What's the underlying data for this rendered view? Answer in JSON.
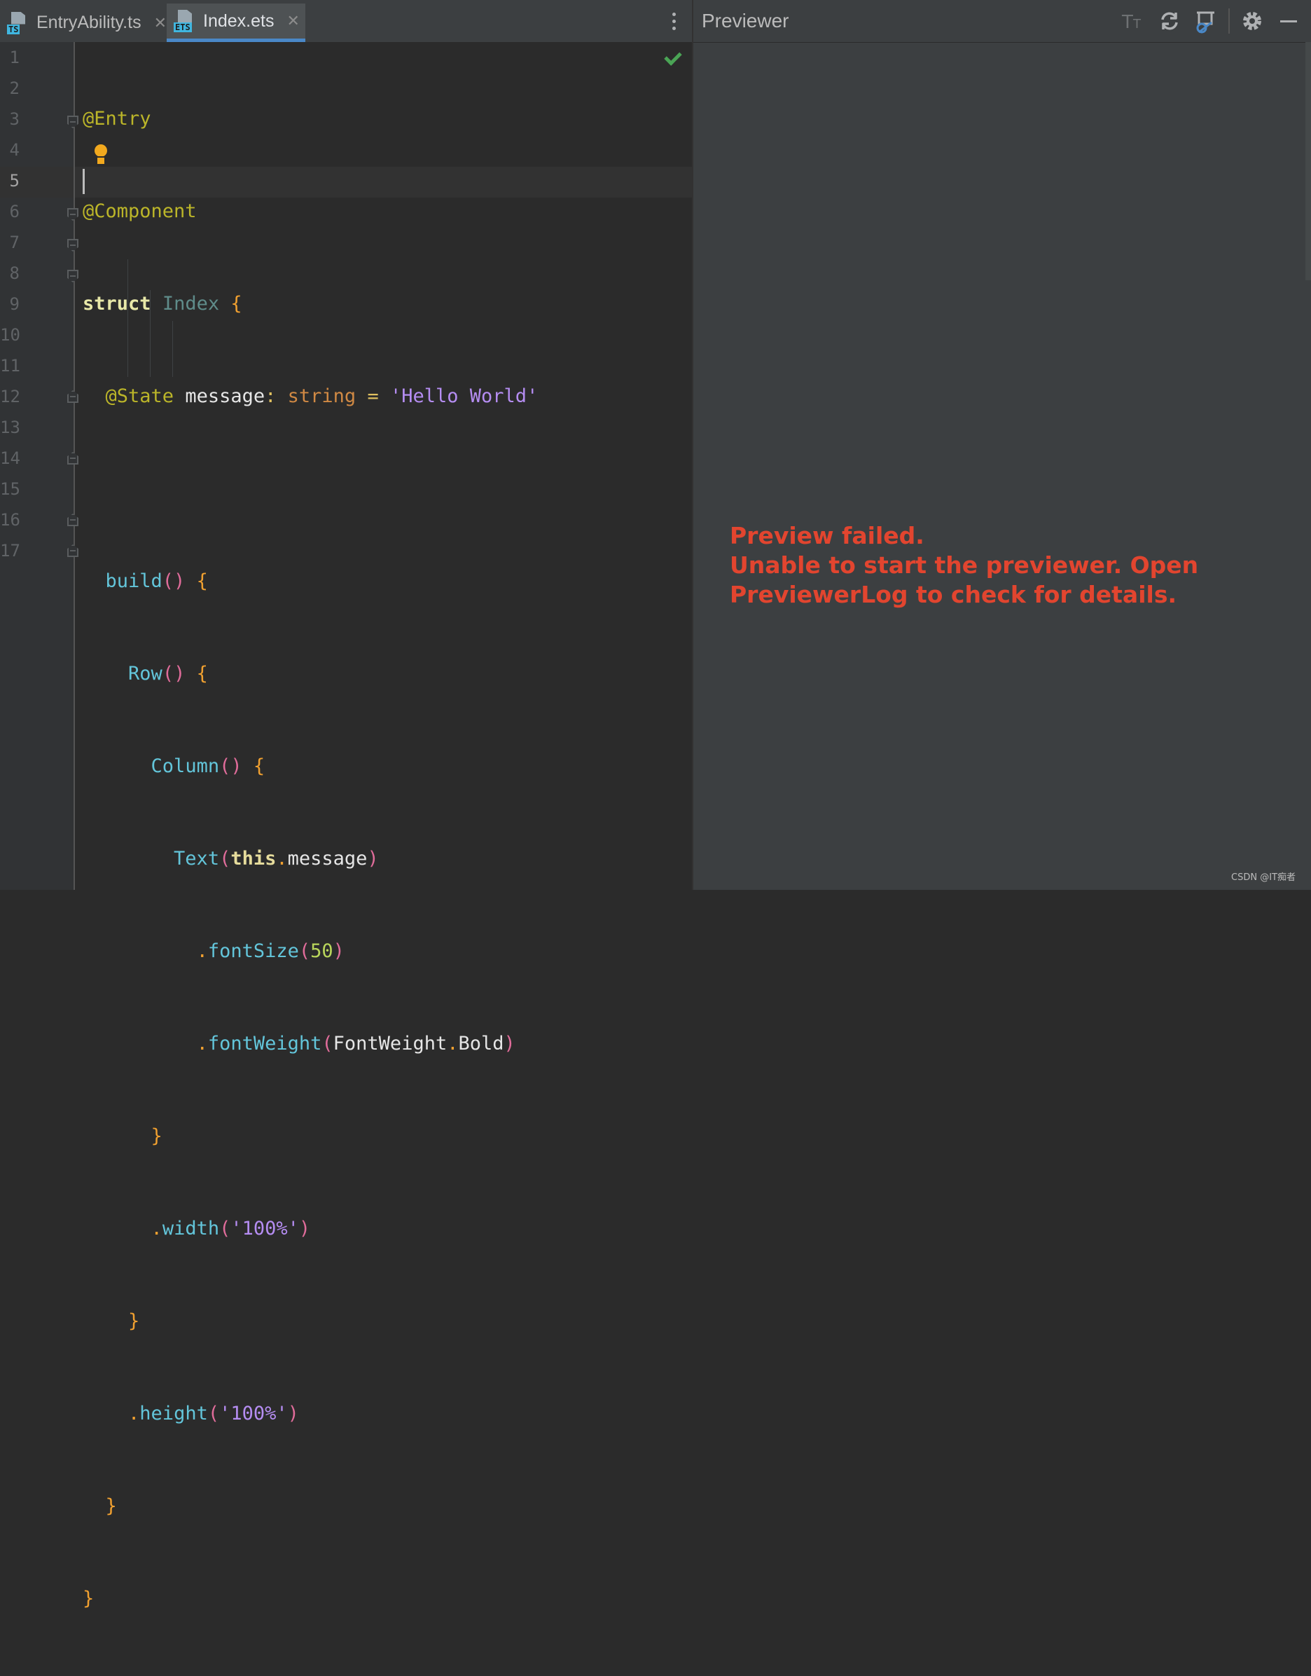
{
  "tabs": [
    {
      "label": "EntryAbility.ts",
      "icon_tag": "TS",
      "active": false
    },
    {
      "label": "Index.ets",
      "icon_tag": "ETS",
      "active": true
    }
  ],
  "editor": {
    "current_line": 5,
    "line_numbers": [
      "1",
      "2",
      "3",
      "4",
      "5",
      "6",
      "7",
      "8",
      "9",
      "10",
      "11",
      "12",
      "13",
      "14",
      "15",
      "16",
      "17"
    ],
    "status": "no-problems-check-icon",
    "code": {
      "l1_ann": "@Entry",
      "l2_ann": "@Component",
      "l3_kw": "struct",
      "l3_name": "Index",
      "l3_brace": "{",
      "l4_ann": "@State",
      "l4_ident": "message",
      "l4_colon": ":",
      "l4_type": "string",
      "l4_eq": "=",
      "l4_str": "'Hello World'",
      "l6_fn": "build",
      "l6_parens": "()",
      "l6_brace": "{",
      "l7_fn": "Row",
      "l7_parens": "()",
      "l7_brace": "{",
      "l8_fn": "Column",
      "l8_parens": "()",
      "l8_brace": "{",
      "l9_fn": "Text",
      "l9_open": "(",
      "l9_this": "this",
      "l9_dot": ".",
      "l9_ident": "message",
      "l9_close": ")",
      "l10_dot": ".",
      "l10_fn": "fontSize",
      "l10_open": "(",
      "l10_num": "50",
      "l10_close": ")",
      "l11_dot": ".",
      "l11_fn": "fontWeight",
      "l11_open": "(",
      "l11_ident": "FontWeight",
      "l11_dot2": ".",
      "l11_ident2": "Bold",
      "l11_close": ")",
      "l12_brace": "}",
      "l13_dot": ".",
      "l13_fn": "width",
      "l13_open": "(",
      "l13_str": "'100%'",
      "l13_close": ")",
      "l14_brace": "}",
      "l15_dot": ".",
      "l15_fn": "height",
      "l15_open": "(",
      "l15_str": "'100%'",
      "l15_close": ")",
      "l16_brace": "}",
      "l17_brace": "}"
    }
  },
  "previewer": {
    "title": "Previewer",
    "error": "Preview failed.\nUnable to start the previewer. Open\nPreviewerLog to check for details.",
    "toolbar": [
      "font-size-icon",
      "refresh-icon",
      "inspector-icon",
      "settings-icon",
      "minimize-icon"
    ]
  },
  "watermark": "CSDN @IT痴者",
  "colors": {
    "accent": "#4a88c7",
    "error": "#e2452f",
    "success": "#4aa455",
    "editor_bg": "#2b2b2b",
    "panel_bg": "#3c3f41"
  }
}
